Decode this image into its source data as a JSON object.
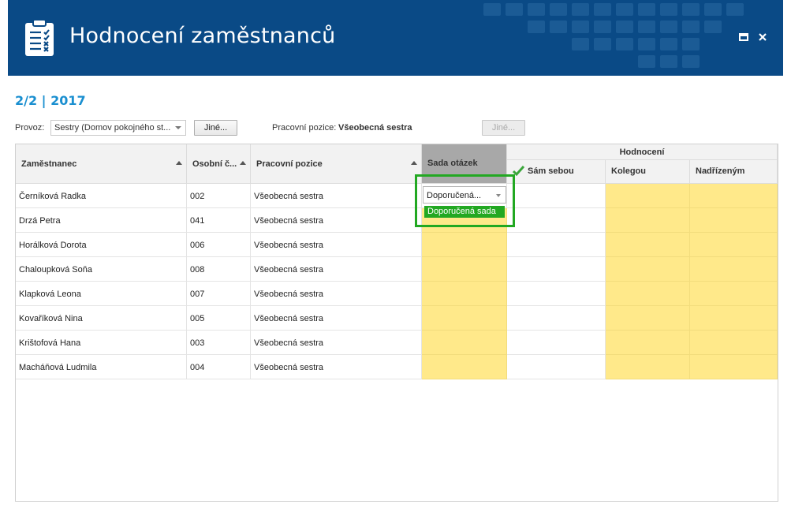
{
  "header": {
    "title": "Hodnocení zaměstnanců",
    "bg_color": "#0a4a86"
  },
  "period": "2/2 | 2017",
  "filters": {
    "provoz_label": "Provoz:",
    "provoz_value": "Sestry (Domov pokojného st...",
    "other_button": "Jiné...",
    "pozice_label": "Pracovní pozice:",
    "pozice_value": "Všeobecná sestra",
    "other_button_2": "Jiné..."
  },
  "grid": {
    "columns": {
      "employee": "Zaměstnanec",
      "personal_no": "Osobní č...",
      "position": "Pracovní pozice",
      "question_set": "Sada otázek",
      "evaluation_group": "Hodnocení",
      "self": "Sám sebou",
      "colleague": "Kolegou",
      "superior": "Nadřízeným"
    },
    "rows": [
      {
        "name": "Černíková Radka",
        "no": "002",
        "position": "Všeobecná sestra"
      },
      {
        "name": "Drzá Petra",
        "no": "041",
        "position": "Všeobecná sestra"
      },
      {
        "name": "Horálková Dorota",
        "no": "006",
        "position": "Všeobecná sestra"
      },
      {
        "name": "Chaloupková Soňa",
        "no": "008",
        "position": "Všeobecná sestra"
      },
      {
        "name": "Klapková Leona",
        "no": "007",
        "position": "Všeobecná sestra"
      },
      {
        "name": "Kovaříková Nina",
        "no": "005",
        "position": "Všeobecná sestra"
      },
      {
        "name": "Krištofová Hana",
        "no": "003",
        "position": "Všeobecná sestra"
      },
      {
        "name": "Macháňová Ludmila",
        "no": "004",
        "position": "Všeobecná sestra"
      }
    ],
    "editor": {
      "value": "Doporučená...",
      "option": "Doporučená sada"
    }
  },
  "colors": {
    "accent": "#1a8fd0",
    "highlight_yellow": "#ffe98a",
    "selection_green": "#22a822"
  }
}
